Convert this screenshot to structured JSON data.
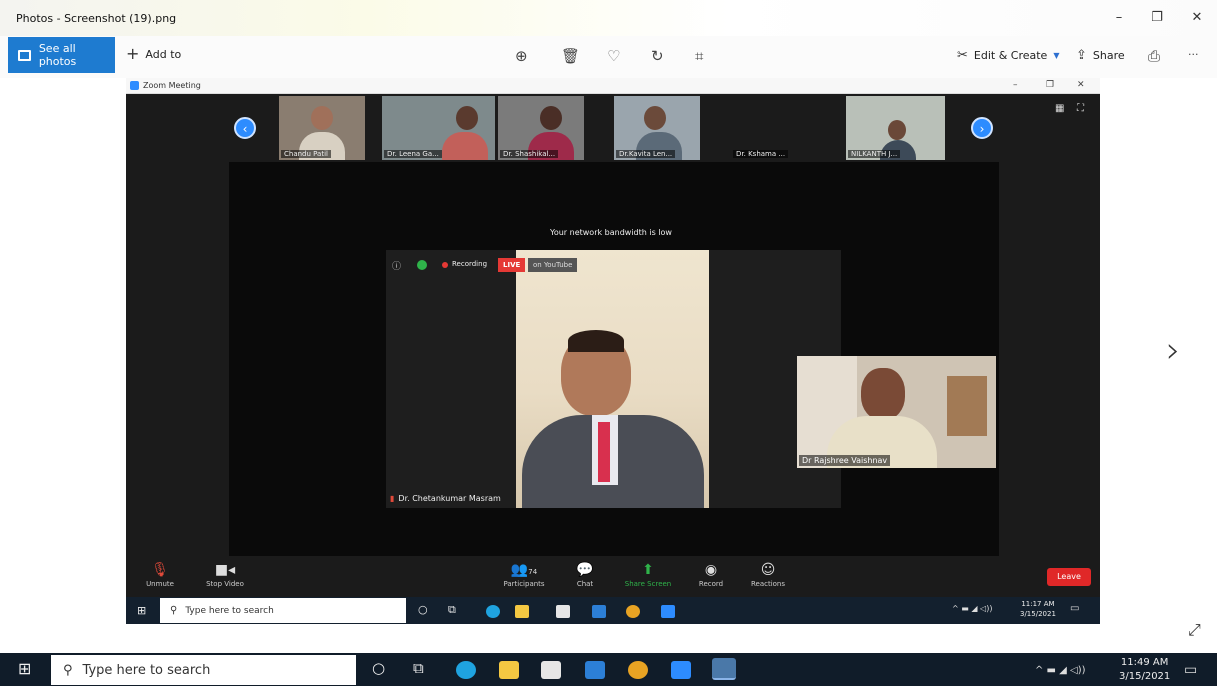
{
  "window": {
    "title": "Photos - Screenshot (19).png",
    "minimize": "–",
    "maximize": "❐",
    "close": "✕"
  },
  "toolbar": {
    "see_all": "See all photos",
    "add_to": "Add to",
    "edit_create": "Edit & Create",
    "share": "Share",
    "more": "···"
  },
  "zoom": {
    "title": "Zoom Meeting",
    "participants_thumbs": [
      "Chandu Patil",
      "Dr. Leena Ga...",
      "Dr. Shashikal...",
      "Dr.Kavita Len...",
      "Dr. Kshama ...",
      "NILKANTH J..."
    ],
    "bandwidth_msg": "Your network bandwidth is low",
    "recording": "Recording",
    "live": "LIVE",
    "on_youtube": "on YouTube",
    "main_speaker": "Dr. Chetankumar Masram",
    "pip_speaker": "Dr Rajshree Vaishnav",
    "controls": {
      "unmute": "Unmute",
      "stop_video": "Stop Video",
      "participants": "Participants",
      "participants_count": "74",
      "chat": "Chat",
      "share_screen": "Share Screen",
      "record": "Record",
      "reactions": "Reactions",
      "leave": "Leave"
    },
    "inner_taskbar": {
      "search_placeholder": "Type here to search",
      "time": "11:17 AM",
      "date": "3/15/2021"
    }
  },
  "taskbar": {
    "search_placeholder": "Type here to search",
    "time": "11:49 AM",
    "date": "3/15/2021"
  },
  "colors": {
    "accent": "#1e7bd0",
    "zoom_blue": "#2d8cff",
    "leave_red": "#e02828",
    "taskbar": "#101c29"
  }
}
